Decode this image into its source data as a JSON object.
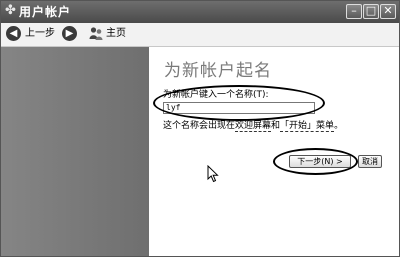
{
  "window": {
    "title": "用户帐户"
  },
  "toolbar": {
    "back_label": "上一步",
    "home_label": "主页"
  },
  "wizard": {
    "heading": "为新帐户起名",
    "field_label": "为新帐户键入一个名称(T):",
    "name_value": "lyf",
    "hint_prefix": "这个名称会出现在",
    "hint_link1": "欢迎屏幕",
    "hint_mid": "和",
    "hint_link2": "「开始」菜单",
    "hint_suffix": "。",
    "next_label": "下一步(N) >",
    "cancel_label": "取消"
  }
}
